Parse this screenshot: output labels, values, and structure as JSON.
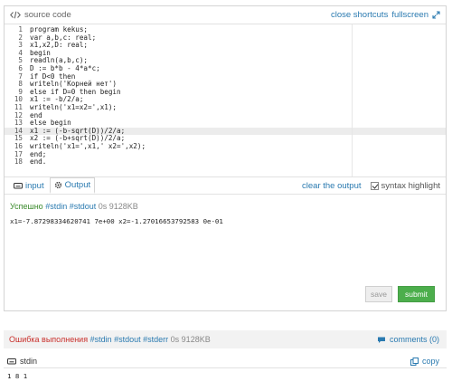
{
  "editor": {
    "title": "source code",
    "title_icon": "code-icon",
    "close_shortcuts": "close shortcuts",
    "fullscreen": "fullscreen",
    "lines": [
      {
        "n": "1",
        "code": "program kekus;"
      },
      {
        "n": "2",
        "code": "var a,b,c: real;"
      },
      {
        "n": "3",
        "code": "x1,x2,D: real;"
      },
      {
        "n": "4",
        "code": "begin"
      },
      {
        "n": "5",
        "code": "readln(a,b,c);"
      },
      {
        "n": "6",
        "code": "D := b*b - 4*a*c;"
      },
      {
        "n": "7",
        "code": "if D<0 then"
      },
      {
        "n": "8",
        "code": "writeln('Корней нет')"
      },
      {
        "n": "9",
        "code": "else if D=0 then begin"
      },
      {
        "n": "10",
        "code": "x1 := -b/2/a;"
      },
      {
        "n": "11",
        "code": "writeln('x1=x2=',x1);"
      },
      {
        "n": "12",
        "code": "end"
      },
      {
        "n": "13",
        "code": "else begin"
      },
      {
        "n": "14",
        "code": "x1 := (-b-sqrt(D))/2/a;"
      },
      {
        "n": "15",
        "code": "x2 := (-b+sqrt(D))/2/a;"
      },
      {
        "n": "16",
        "code": "writeln('x1=',x1,' x2=',x2);"
      },
      {
        "n": "17",
        "code": "end;"
      },
      {
        "n": "18",
        "code": "end."
      }
    ]
  },
  "tabs": {
    "input": "input",
    "output": "Output",
    "clear": "clear the output",
    "syntax": "syntax highlight"
  },
  "result": {
    "status": "Успешно",
    "tags": "#stdin #stdout",
    "stats": "0s 9128KB",
    "output": "x1=-7.87298334620741 7e+00 x2=-1.27016653792583 0e-01"
  },
  "buttons": {
    "save": "save",
    "submit": "submit"
  },
  "error_bar": {
    "status": "Ошибка выполнения",
    "tags": "#stdin #stdout #stderr",
    "stats": "0s 9128KB",
    "comments": "comments (0)"
  },
  "stdin": {
    "title": "stdin",
    "copy": "copy",
    "value": "1 8 1"
  }
}
